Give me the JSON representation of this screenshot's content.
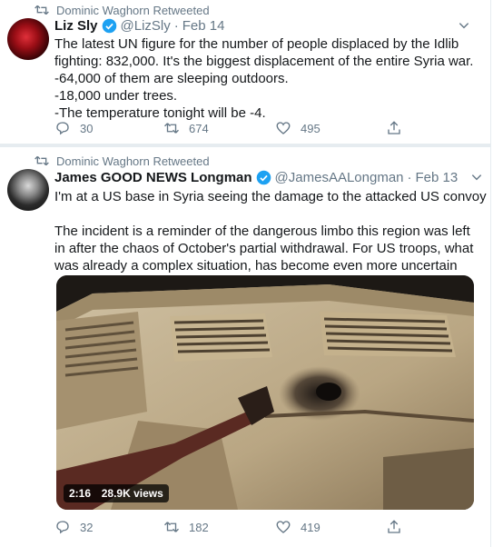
{
  "tweets": [
    {
      "retweeted_by": "Dominic Waghorn Retweeted",
      "name": "Liz Sly",
      "handle": "@LizSly",
      "date": "Feb 14",
      "lines": [
        "The latest UN figure for the number of people displaced by the Idlib",
        "fighting: 832,000. It's the biggest displacement of the entire Syria war.",
        "-64,000 of them are sleeping outdoors.",
        "-18,000 under trees.",
        "-The temperature tonight will be -4."
      ],
      "replies": "30",
      "retweets": "674",
      "likes": "495"
    },
    {
      "retweeted_by": "Dominic Waghorn Retweeted",
      "name": "James GOOD NEWS Longman",
      "handle": "@JamesAALongman",
      "date": "Feb 13",
      "lines": [
        "I'm at a US base in Syria seeing the damage to the attacked US convoy",
        "",
        "The incident is a reminder of the dangerous limbo this region was left",
        "in after the chaos of October's partial withdrawal. For US troops, what",
        "was already a complex situation, has become even more uncertain"
      ],
      "video_duration": "2:16",
      "video_views": "28.9K views",
      "replies": "32",
      "retweets": "182",
      "likes": "419"
    }
  ],
  "colors": {
    "text": "#14171a",
    "muted": "#657786",
    "verified": "#1da1f2",
    "divider": "#e6ecf0"
  },
  "icons": [
    "retweet-icon",
    "verified-badge-icon",
    "chevron-down-icon",
    "reply-icon",
    "like-icon",
    "share-icon"
  ]
}
